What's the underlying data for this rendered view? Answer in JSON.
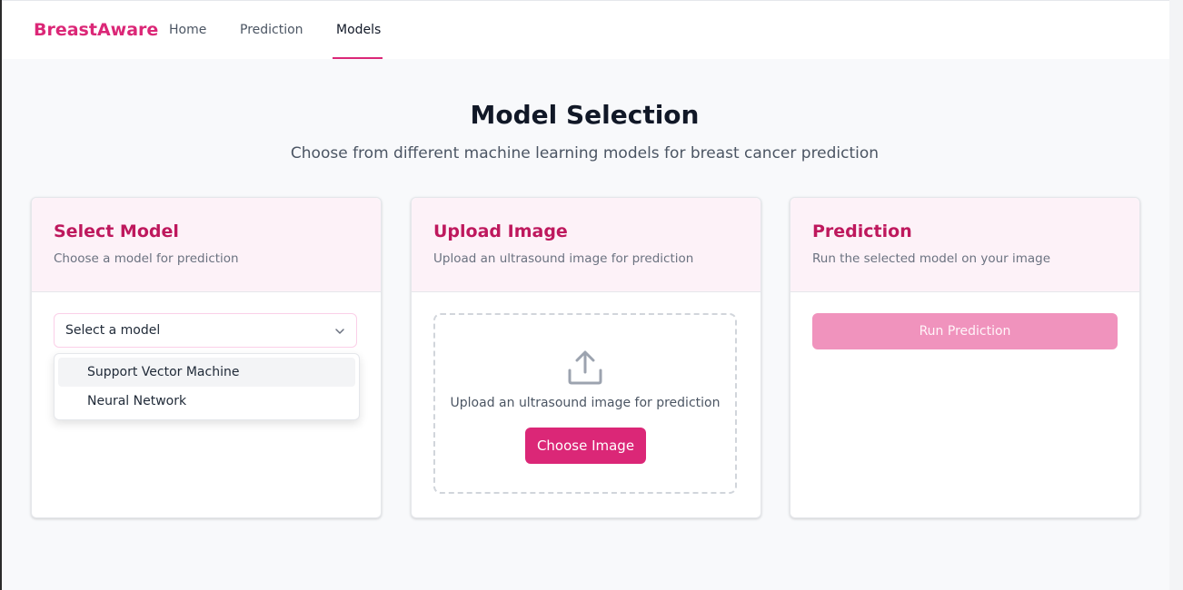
{
  "nav": {
    "brand": "BreastAware",
    "links": [
      {
        "label": "Home"
      },
      {
        "label": "Prediction"
      },
      {
        "label": "Models",
        "active": true
      }
    ]
  },
  "page": {
    "title": "Model Selection",
    "subtitle": "Choose from different machine learning models for breast cancer prediction"
  },
  "cards": {
    "select_model": {
      "title": "Select Model",
      "description": "Choose a model for prediction",
      "select_value": "Select a model",
      "options": [
        "Support Vector Machine",
        "Neural Network"
      ]
    },
    "upload_image": {
      "title": "Upload Image",
      "description": "Upload an ultrasound image for prediction",
      "dropzone_text": "Upload an ultrasound image for prediction",
      "button_label": "Choose Image"
    },
    "prediction": {
      "title": "Prediction",
      "description": "Run the selected model on your image",
      "button_label": "Run Prediction"
    }
  },
  "icons": {
    "chevron": "chevron-down-icon",
    "upload": "upload-icon"
  },
  "colors": {
    "accent": "#db2777",
    "card_header_bg": "#fdf2f8",
    "title_pink": "#be185d",
    "disabled_button": "#f093bd"
  }
}
